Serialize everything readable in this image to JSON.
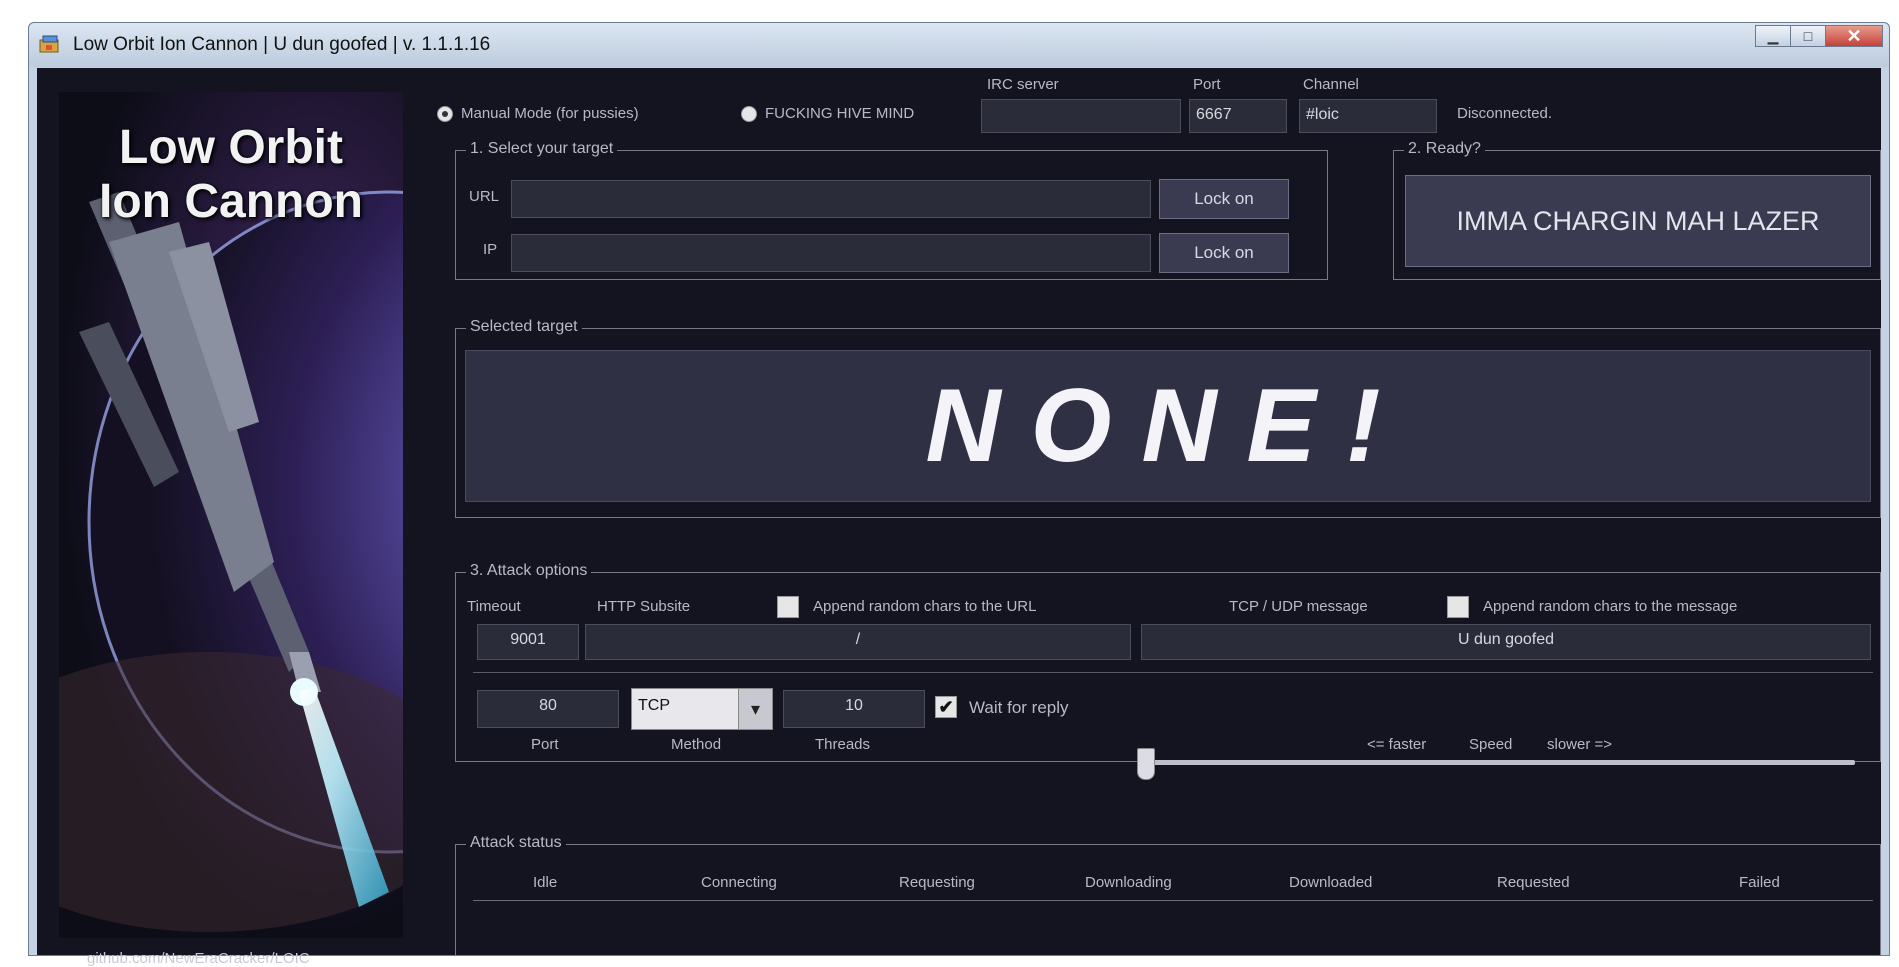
{
  "window": {
    "title": "Low Orbit Ion Cannon | U dun goofed | v. 1.1.1.16",
    "minimize_glyph": "▁",
    "maximize_glyph": "□",
    "close_glyph": "✕"
  },
  "poster": {
    "title_line1": "Low Orbit",
    "title_line2": "Ion Cannon",
    "github_link": "github.com/NewEraCracker/LOIC"
  },
  "mode": {
    "manual_label": "Manual Mode (for pussies)",
    "hive_label": "FUCKING HIVE MIND",
    "selected": "manual"
  },
  "irc": {
    "server_label": "IRC server",
    "server_value": "",
    "port_label": "Port",
    "port_value": "6667",
    "channel_label": "Channel",
    "channel_value": "#loic",
    "status": "Disconnected."
  },
  "target": {
    "group_title": "1. Select your target",
    "url_label": "URL",
    "url_value": "",
    "ip_label": "IP",
    "ip_value": "",
    "lock_on_label": "Lock on"
  },
  "ready": {
    "group_title": "2. Ready?",
    "fire_button": "IMMA CHARGIN MAH LAZER"
  },
  "selected_target": {
    "group_title": "Selected target",
    "value": "NONE!"
  },
  "attack_options": {
    "group_title": "3. Attack options",
    "timeout_label": "Timeout",
    "timeout_value": "9001",
    "subsite_label": "HTTP Subsite",
    "subsite_value": "/",
    "append_url_label": "Append random chars to the URL",
    "append_url_checked": false,
    "tcpudp_label": "TCP / UDP message",
    "message_value": "U dun goofed",
    "append_msg_label": "Append random chars to the message",
    "append_msg_checked": false,
    "port_value": "80",
    "port_label": "Port",
    "method_value": "TCP",
    "method_label": "Method",
    "threads_value": "10",
    "threads_label": "Threads",
    "wait_reply_label": "Wait for reply",
    "wait_reply_checked": true,
    "check_glyph": "✔",
    "dropdown_glyph": "▾",
    "speed_faster": "<= faster",
    "speed_label": "Speed",
    "speed_slower": "slower =>",
    "speed_level": 0
  },
  "attack_status": {
    "group_title": "Attack status",
    "columns": [
      "Idle",
      "Connecting",
      "Requesting",
      "Downloading",
      "Downloaded",
      "Requested",
      "Failed"
    ]
  }
}
